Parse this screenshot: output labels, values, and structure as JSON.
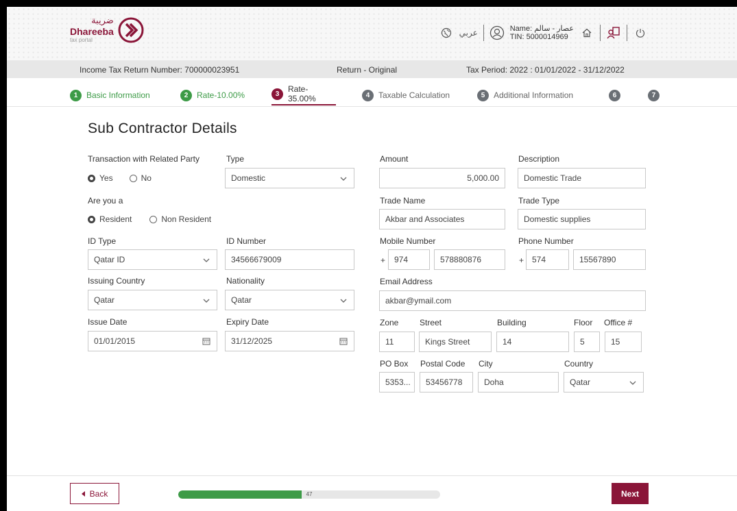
{
  "header": {
    "logo_arabic": "ضريبة",
    "logo_name": "Dhareeba",
    "logo_sub": "tax portal",
    "language_label": "عربي",
    "user_name_line": "Name: عصار - سالم",
    "user_tin_line": "TIN: 5000014969"
  },
  "infobar": {
    "return_number": "Income Tax Return Number: 700000023951",
    "return_type": "Return - Original",
    "tax_period": "Tax Period: 2022 : 01/01/2022 - 31/12/2022"
  },
  "steps": [
    {
      "num": "1",
      "label": "Basic Information",
      "state": "done"
    },
    {
      "num": "2",
      "label": "Rate-10.00%",
      "state": "done"
    },
    {
      "num": "3",
      "label": "Rate-35.00%",
      "state": "active"
    },
    {
      "num": "4",
      "label": "Taxable Calculation",
      "state": "todo"
    },
    {
      "num": "5",
      "label": "Additional Information",
      "state": "todo"
    },
    {
      "num": "6",
      "label": "",
      "state": "todo"
    },
    {
      "num": "7",
      "label": "",
      "state": "todo"
    }
  ],
  "page_title": "Sub Contractor Details",
  "form": {
    "related_party": {
      "label": "Transaction with Related Party",
      "yes": "Yes",
      "no": "No",
      "selected": "Yes"
    },
    "type": {
      "label": "Type",
      "value": "Domestic"
    },
    "amount": {
      "label": "Amount",
      "value": "5,000.00"
    },
    "description": {
      "label": "Description",
      "value": "Domestic Trade"
    },
    "are_you": {
      "label": "Are you a",
      "resident": "Resident",
      "non_resident": "Non Resident",
      "selected": "Resident"
    },
    "trade_name": {
      "label": "Trade Name",
      "value": "Akbar and Associates"
    },
    "trade_type": {
      "label": "Trade Type",
      "value": "Domestic supplies"
    },
    "id_type": {
      "label": "ID Type",
      "value": "Qatar ID"
    },
    "id_number": {
      "label": "ID Number",
      "value": "34566679009"
    },
    "mobile": {
      "label": "Mobile Number",
      "plus": "+",
      "code": "974",
      "number": "578880876"
    },
    "phone": {
      "label": "Phone Number",
      "plus": "+",
      "code": "574",
      "number": "15567890"
    },
    "issuing_country": {
      "label": "Issuing Country",
      "value": "Qatar"
    },
    "nationality": {
      "label": "Nationality",
      "value": "Qatar"
    },
    "email": {
      "label": "Email Address",
      "value": "akbar@ymail.com"
    },
    "issue_date": {
      "label": "Issue Date",
      "value": "01/01/2015"
    },
    "expiry_date": {
      "label": "Expiry Date",
      "value": "31/12/2025"
    },
    "zone": {
      "label": "Zone",
      "value": "11"
    },
    "street": {
      "label": "Street",
      "value": "Kings Street"
    },
    "building": {
      "label": "Building",
      "value": "14"
    },
    "floor": {
      "label": "Floor",
      "value": "5"
    },
    "office": {
      "label": "Office #",
      "value": "15"
    },
    "po_box": {
      "label": "PO Box",
      "value": "5353..."
    },
    "postal_code": {
      "label": "Postal Code",
      "value": "53456778"
    },
    "city": {
      "label": "City",
      "value": "Doha"
    },
    "country": {
      "label": "Country",
      "value": "Qatar"
    }
  },
  "footer": {
    "back_label": "Back",
    "progress_value": 47,
    "progress_text": "47",
    "next_label": "Next"
  },
  "colors": {
    "brand": "#8a1538",
    "success": "#3d9b47",
    "step_todo": "#6a6f75"
  }
}
